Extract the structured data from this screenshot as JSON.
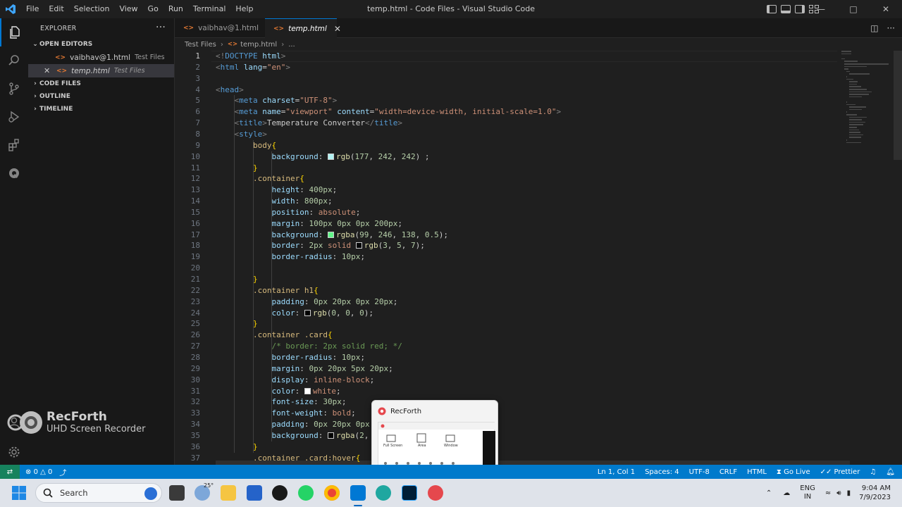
{
  "window": {
    "title": "temp.html - Code Files - Visual Studio Code",
    "menu": [
      "File",
      "Edit",
      "Selection",
      "View",
      "Go",
      "Run",
      "Terminal",
      "Help"
    ]
  },
  "sidebar": {
    "header": "EXPLORER",
    "more": "···",
    "sections": {
      "open_editors": "OPEN EDITORS",
      "code_files": "CODE FILES",
      "outline": "OUTLINE",
      "timeline": "TIMELINE"
    },
    "open_files": [
      {
        "name": "vaibhav@1.html",
        "desc": "Test Files"
      },
      {
        "name": "temp.html",
        "desc": "Test Files"
      }
    ]
  },
  "watermark": {
    "brand": "RecForth",
    "tagline": "UHD Screen Recorder"
  },
  "tabs": [
    {
      "label": "vaibhav@1.html"
    },
    {
      "label": "temp.html"
    }
  ],
  "breadcrumb": {
    "folder": "Test Files",
    "file": "temp.html",
    "tail": "..."
  },
  "editor": {
    "current_line": 1,
    "line_numbers": [
      "1",
      "2",
      "3",
      "4",
      "5",
      "6",
      "7",
      "8",
      "9",
      "10",
      "11",
      "12",
      "13",
      "14",
      "15",
      "16",
      "17",
      "18",
      "19",
      "20",
      "21",
      "22",
      "23",
      "24",
      "25",
      "26",
      "27",
      "28",
      "29",
      "30",
      "31",
      "32",
      "33",
      "34",
      "35",
      "36",
      "37"
    ],
    "swatch_colors": {
      "line10": "#b1f2f2",
      "line17": "#63f68a",
      "line18": "#030507",
      "line24": "#000000",
      "line31": "#ffffff",
      "line35": "#020202"
    },
    "lines": [
      [
        [
          "t-punc",
          "<!"
        ],
        [
          "t-tag",
          "DOCTYPE"
        ],
        [
          "t-txt",
          " "
        ],
        [
          "t-attr",
          "html"
        ],
        [
          "t-punc",
          ">"
        ]
      ],
      [
        [
          "t-punc",
          "<"
        ],
        [
          "t-tag",
          "html"
        ],
        [
          "t-txt",
          " "
        ],
        [
          "t-attr",
          "lang"
        ],
        [
          "t-txt",
          "="
        ],
        [
          "t-str",
          "\"en\""
        ],
        [
          "t-punc",
          ">"
        ]
      ],
      [],
      [
        [
          "t-punc",
          "<"
        ],
        [
          "t-tag",
          "head"
        ],
        [
          "t-punc",
          ">"
        ]
      ],
      [
        [
          "t-txt",
          "    "
        ],
        [
          "t-punc",
          "<"
        ],
        [
          "t-tag",
          "meta"
        ],
        [
          "t-txt",
          " "
        ],
        [
          "t-attr",
          "charset"
        ],
        [
          "t-txt",
          "="
        ],
        [
          "t-str",
          "\"UTF-8\""
        ],
        [
          "t-punc",
          ">"
        ]
      ],
      [
        [
          "t-txt",
          "    "
        ],
        [
          "t-punc",
          "<"
        ],
        [
          "t-tag",
          "meta"
        ],
        [
          "t-txt",
          " "
        ],
        [
          "t-attr",
          "name"
        ],
        [
          "t-txt",
          "="
        ],
        [
          "t-str",
          "\"viewport\""
        ],
        [
          "t-txt",
          " "
        ],
        [
          "t-attr",
          "content"
        ],
        [
          "t-txt",
          "="
        ],
        [
          "t-str",
          "\"width=device-width, initial-scale=1.0\""
        ],
        [
          "t-punc",
          ">"
        ]
      ],
      [
        [
          "t-txt",
          "    "
        ],
        [
          "t-punc",
          "<"
        ],
        [
          "t-tag",
          "title"
        ],
        [
          "t-punc",
          ">"
        ],
        [
          "t-txt",
          "Temperature Converter"
        ],
        [
          "t-punc",
          "</"
        ],
        [
          "t-tag",
          "title"
        ],
        [
          "t-punc",
          ">"
        ]
      ],
      [
        [
          "t-txt",
          "    "
        ],
        [
          "t-punc",
          "<"
        ],
        [
          "t-tag",
          "style"
        ],
        [
          "t-punc",
          ">"
        ]
      ],
      [
        [
          "t-txt",
          "        "
        ],
        [
          "t-sel",
          "body"
        ],
        [
          "t-brk",
          "{"
        ]
      ],
      [
        [
          "t-txt",
          "            "
        ],
        [
          "t-prop",
          "background"
        ],
        [
          "t-txt",
          ": "
        ],
        [
          "swatch",
          "line10"
        ],
        [
          "t-fn",
          "rgb"
        ],
        [
          "t-txt",
          "("
        ],
        [
          "t-num",
          "177"
        ],
        [
          "t-txt",
          ", "
        ],
        [
          "t-num",
          "242"
        ],
        [
          "t-txt",
          ", "
        ],
        [
          "t-num",
          "242"
        ],
        [
          "t-txt",
          ") ;"
        ]
      ],
      [
        [
          "t-txt",
          "        "
        ],
        [
          "t-brk",
          "}"
        ]
      ],
      [
        [
          "t-txt",
          "        "
        ],
        [
          "t-sel",
          ".container"
        ],
        [
          "t-brk",
          "{"
        ]
      ],
      [
        [
          "t-txt",
          "            "
        ],
        [
          "t-prop",
          "height"
        ],
        [
          "t-txt",
          ": "
        ],
        [
          "t-num",
          "400px"
        ],
        [
          "t-txt",
          ";"
        ]
      ],
      [
        [
          "t-txt",
          "            "
        ],
        [
          "t-prop",
          "width"
        ],
        [
          "t-txt",
          ": "
        ],
        [
          "t-num",
          "800px"
        ],
        [
          "t-txt",
          ";"
        ]
      ],
      [
        [
          "t-txt",
          "            "
        ],
        [
          "t-prop",
          "position"
        ],
        [
          "t-txt",
          ": "
        ],
        [
          "t-val",
          "absolute"
        ],
        [
          "t-txt",
          ";"
        ]
      ],
      [
        [
          "t-txt",
          "            "
        ],
        [
          "t-prop",
          "margin"
        ],
        [
          "t-txt",
          ": "
        ],
        [
          "t-num",
          "100px"
        ],
        [
          "t-txt",
          " "
        ],
        [
          "t-num",
          "0px"
        ],
        [
          "t-txt",
          " "
        ],
        [
          "t-num",
          "0px"
        ],
        [
          "t-txt",
          " "
        ],
        [
          "t-num",
          "200px"
        ],
        [
          "t-txt",
          ";"
        ]
      ],
      [
        [
          "t-txt",
          "            "
        ],
        [
          "t-prop",
          "background"
        ],
        [
          "t-txt",
          ": "
        ],
        [
          "swatch",
          "line17"
        ],
        [
          "t-fn",
          "rgba"
        ],
        [
          "t-txt",
          "("
        ],
        [
          "t-num",
          "99"
        ],
        [
          "t-txt",
          ", "
        ],
        [
          "t-num",
          "246"
        ],
        [
          "t-txt",
          ", "
        ],
        [
          "t-num",
          "138"
        ],
        [
          "t-txt",
          ", "
        ],
        [
          "t-num",
          "0.5"
        ],
        [
          "t-txt",
          ");"
        ]
      ],
      [
        [
          "t-txt",
          "            "
        ],
        [
          "t-prop",
          "border"
        ],
        [
          "t-txt",
          ": "
        ],
        [
          "t-num",
          "2px"
        ],
        [
          "t-txt",
          " "
        ],
        [
          "t-val",
          "solid"
        ],
        [
          "t-txt",
          " "
        ],
        [
          "swatch",
          "line18"
        ],
        [
          "t-fn",
          "rgb"
        ],
        [
          "t-txt",
          "("
        ],
        [
          "t-num",
          "3"
        ],
        [
          "t-txt",
          ", "
        ],
        [
          "t-num",
          "5"
        ],
        [
          "t-txt",
          ", "
        ],
        [
          "t-num",
          "7"
        ],
        [
          "t-txt",
          ");"
        ]
      ],
      [
        [
          "t-txt",
          "            "
        ],
        [
          "t-prop",
          "border-radius"
        ],
        [
          "t-txt",
          ": "
        ],
        [
          "t-num",
          "10px"
        ],
        [
          "t-txt",
          ";"
        ]
      ],
      [],
      [
        [
          "t-txt",
          "        "
        ],
        [
          "t-brk",
          "}"
        ]
      ],
      [
        [
          "t-txt",
          "        "
        ],
        [
          "t-sel",
          ".container h1"
        ],
        [
          "t-brk",
          "{"
        ]
      ],
      [
        [
          "t-txt",
          "            "
        ],
        [
          "t-prop",
          "padding"
        ],
        [
          "t-txt",
          ": "
        ],
        [
          "t-num",
          "0px"
        ],
        [
          "t-txt",
          " "
        ],
        [
          "t-num",
          "20px"
        ],
        [
          "t-txt",
          " "
        ],
        [
          "t-num",
          "0px"
        ],
        [
          "t-txt",
          " "
        ],
        [
          "t-num",
          "20px"
        ],
        [
          "t-txt",
          ";"
        ]
      ],
      [
        [
          "t-txt",
          "            "
        ],
        [
          "t-prop",
          "color"
        ],
        [
          "t-txt",
          ": "
        ],
        [
          "swatch",
          "line24"
        ],
        [
          "t-fn",
          "rgb"
        ],
        [
          "t-txt",
          "("
        ],
        [
          "t-num",
          "0"
        ],
        [
          "t-txt",
          ", "
        ],
        [
          "t-num",
          "0"
        ],
        [
          "t-txt",
          ", "
        ],
        [
          "t-num",
          "0"
        ],
        [
          "t-txt",
          ");"
        ]
      ],
      [
        [
          "t-txt",
          "        "
        ],
        [
          "t-brk",
          "}"
        ]
      ],
      [
        [
          "t-txt",
          "        "
        ],
        [
          "t-sel",
          ".container .card"
        ],
        [
          "t-brk",
          "{"
        ]
      ],
      [
        [
          "t-txt",
          "            "
        ],
        [
          "t-com",
          "/* border: 2px solid red; */"
        ]
      ],
      [
        [
          "t-txt",
          "            "
        ],
        [
          "t-prop",
          "border-radius"
        ],
        [
          "t-txt",
          ": "
        ],
        [
          "t-num",
          "10px"
        ],
        [
          "t-txt",
          ";"
        ]
      ],
      [
        [
          "t-txt",
          "            "
        ],
        [
          "t-prop",
          "margin"
        ],
        [
          "t-txt",
          ": "
        ],
        [
          "t-num",
          "0px"
        ],
        [
          "t-txt",
          " "
        ],
        [
          "t-num",
          "20px"
        ],
        [
          "t-txt",
          " "
        ],
        [
          "t-num",
          "5px"
        ],
        [
          "t-txt",
          " "
        ],
        [
          "t-num",
          "20px"
        ],
        [
          "t-txt",
          ";"
        ]
      ],
      [
        [
          "t-txt",
          "            "
        ],
        [
          "t-prop",
          "display"
        ],
        [
          "t-txt",
          ": "
        ],
        [
          "t-val",
          "inline-block"
        ],
        [
          "t-txt",
          ";"
        ]
      ],
      [
        [
          "t-txt",
          "            "
        ],
        [
          "t-prop",
          "color"
        ],
        [
          "t-txt",
          ": "
        ],
        [
          "swatch",
          "line31"
        ],
        [
          "t-val",
          "white"
        ],
        [
          "t-txt",
          ";"
        ]
      ],
      [
        [
          "t-txt",
          "            "
        ],
        [
          "t-prop",
          "font-size"
        ],
        [
          "t-txt",
          ": "
        ],
        [
          "t-num",
          "30px"
        ],
        [
          "t-txt",
          ";"
        ]
      ],
      [
        [
          "t-txt",
          "            "
        ],
        [
          "t-prop",
          "font-weight"
        ],
        [
          "t-txt",
          ": "
        ],
        [
          "t-val",
          "bold"
        ],
        [
          "t-txt",
          ";"
        ]
      ],
      [
        [
          "t-txt",
          "            "
        ],
        [
          "t-prop",
          "padding"
        ],
        [
          "t-txt",
          ": "
        ],
        [
          "t-num",
          "0px"
        ],
        [
          "t-txt",
          " "
        ],
        [
          "t-num",
          "20px"
        ],
        [
          "t-txt",
          " "
        ],
        [
          "t-num",
          "0px"
        ],
        [
          "t-txt",
          " "
        ],
        [
          "t-num",
          "1"
        ]
      ],
      [
        [
          "t-txt",
          "            "
        ],
        [
          "t-prop",
          "background"
        ],
        [
          "t-txt",
          ": "
        ],
        [
          "swatch",
          "line35"
        ],
        [
          "t-fn",
          "rgba"
        ],
        [
          "t-txt",
          "("
        ],
        [
          "t-num",
          "2"
        ],
        [
          "t-txt",
          ", "
        ]
      ],
      [
        [
          "t-txt",
          "        "
        ],
        [
          "t-brk",
          "}"
        ]
      ],
      [
        [
          "t-txt",
          "        "
        ],
        [
          "t-sel",
          ".container .card:hover"
        ],
        [
          "t-brk",
          "{"
        ]
      ]
    ]
  },
  "popup": {
    "title": "RecForth",
    "icon": "recforth-logo-icon",
    "preview_labels": [
      "Full Screen",
      "Area",
      "Window"
    ]
  },
  "status": {
    "errors": "0",
    "warnings": "0",
    "position": "Ln 1, Col 1",
    "spaces": "Spaces: 4",
    "encoding": "UTF-8",
    "eol": "CRLF",
    "language": "HTML",
    "live": "Go Live",
    "prettier": "Prettier"
  },
  "taskbar": {
    "search_placeholder": "Search",
    "weather": "25°",
    "lang1": "ENG",
    "lang2": "IN",
    "time": "9:04 AM",
    "date": "7/9/2023"
  },
  "colors": {
    "accent": "#0078d4",
    "statusbar": "#007acc",
    "remote": "#16825d",
    "html_icon": "#e37933"
  }
}
